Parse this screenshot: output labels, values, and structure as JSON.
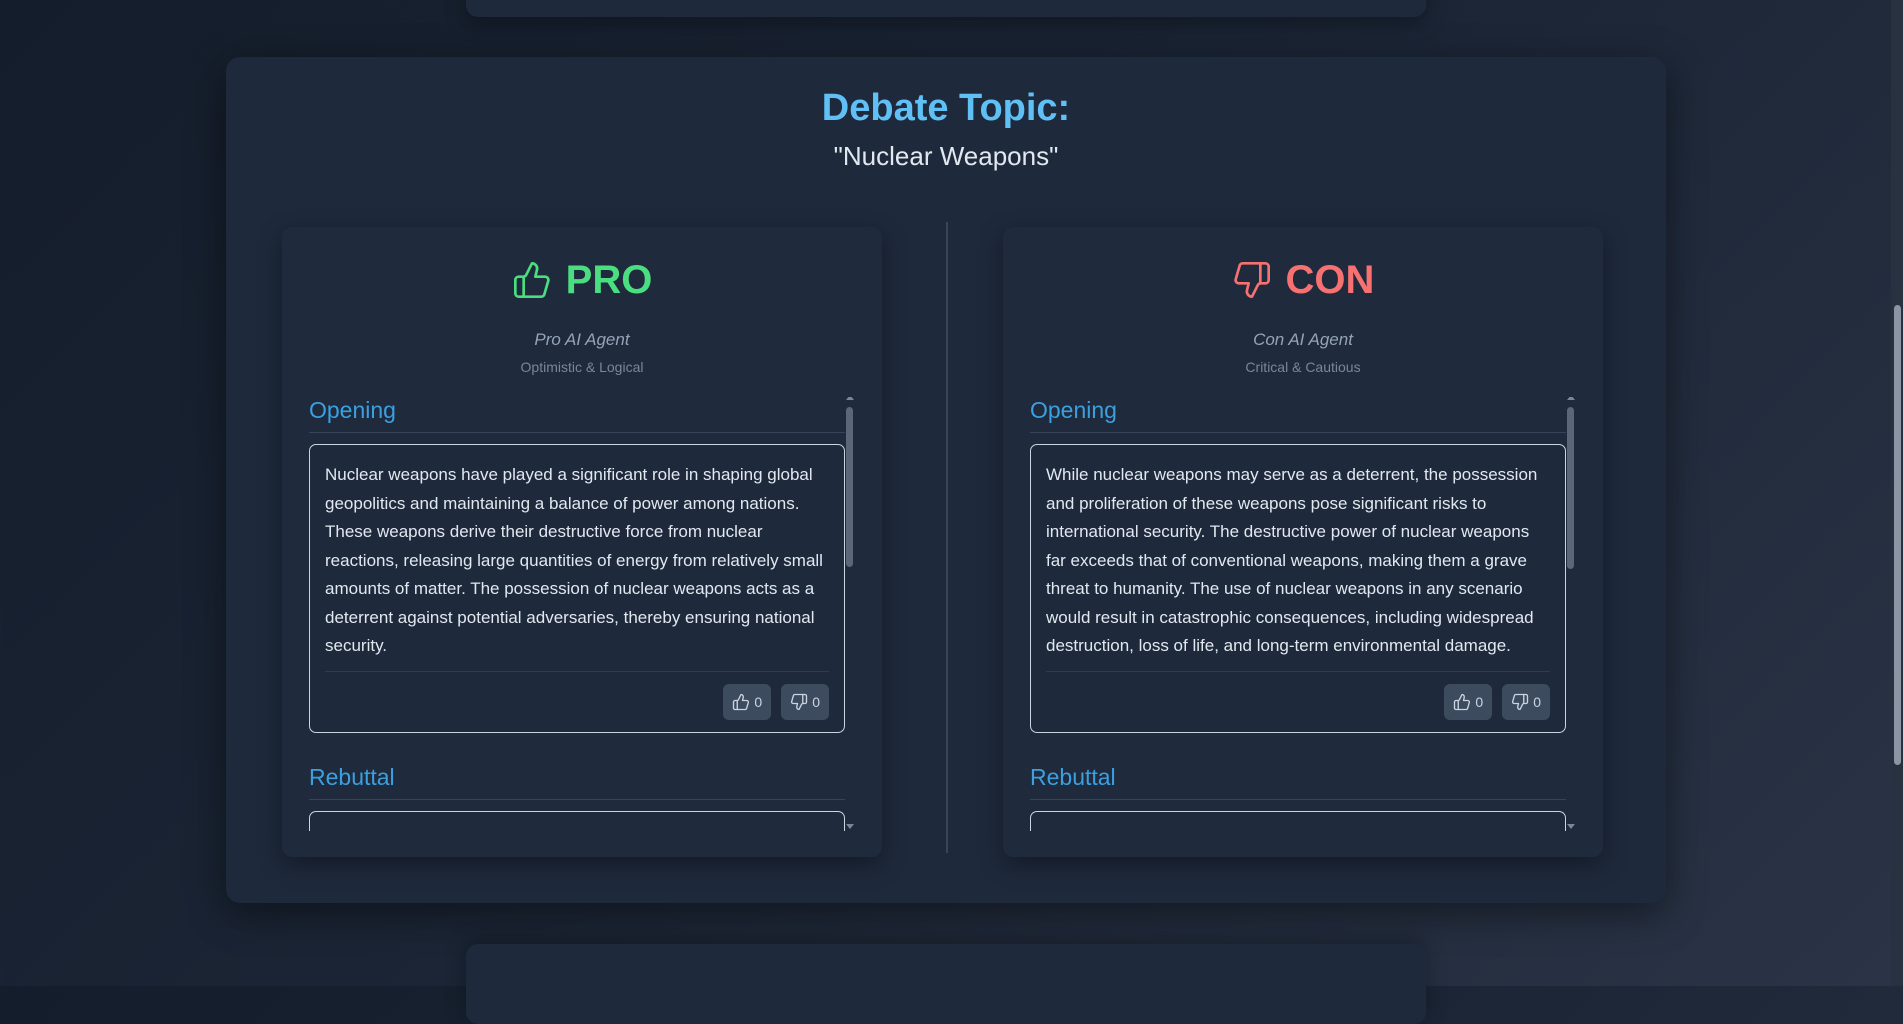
{
  "debate": {
    "heading": "Debate Topic:",
    "topic": "\"Nuclear Weapons\""
  },
  "pro": {
    "label": "PRO",
    "icon": "thumbs-up-icon",
    "color": "#4ade80",
    "agent_name": "Pro AI Agent",
    "agent_desc": "Optimistic & Logical",
    "sections": {
      "opening_title": "Opening",
      "opening_text": "Nuclear weapons have played a significant role in shaping global geopolitics and maintaining a balance of power among nations. These weapons derive their destructive force from nuclear reactions, releasing large quantities of energy from relatively small amounts of matter. The possession of nuclear weapons acts as a deterrent against potential adversaries, thereby ensuring national security.",
      "upvotes": "0",
      "downvotes": "0",
      "rebuttal_title": "Rebuttal"
    }
  },
  "con": {
    "label": "CON",
    "icon": "thumbs-down-icon",
    "color": "#f87171",
    "agent_name": "Con AI Agent",
    "agent_desc": "Critical & Cautious",
    "sections": {
      "opening_title": "Opening",
      "opening_text": "While nuclear weapons may serve as a deterrent, the possession and proliferation of these weapons pose significant risks to international security. The destructive power of nuclear weapons far exceeds that of conventional weapons, making them a grave threat to humanity. The use of nuclear weapons in any scenario would result in catastrophic consequences, including widespread destruction, loss of life, and long-term environmental damage.",
      "upvotes": "0",
      "downvotes": "0",
      "rebuttal_title": "Rebuttal"
    }
  }
}
